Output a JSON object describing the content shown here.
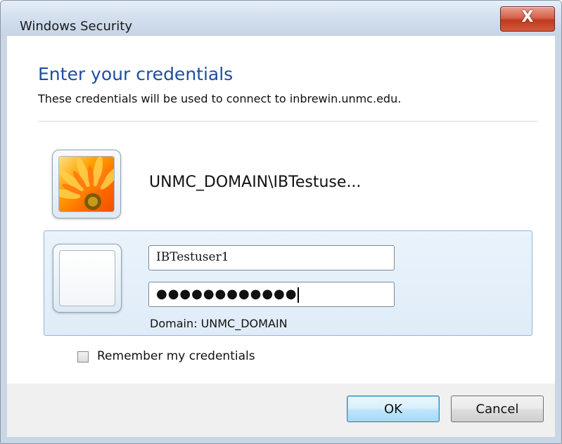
{
  "window": {
    "title": "Windows Security",
    "close_label": "X"
  },
  "content": {
    "heading": "Enter your credentials",
    "subheading": "These credentials will be used to connect to inbrewin.unmc.edu."
  },
  "saved_account": {
    "name": "UNMC_DOMAIN\\IBTestuse..."
  },
  "credentials": {
    "username_value": "IBTestuser1",
    "password_value": "●●●●●●●●●●●●",
    "domain_label": "Domain: UNMC_DOMAIN"
  },
  "remember": {
    "label": "Remember my credentials",
    "checked": false
  },
  "footer": {
    "ok_label": "OK",
    "cancel_label": "Cancel"
  }
}
